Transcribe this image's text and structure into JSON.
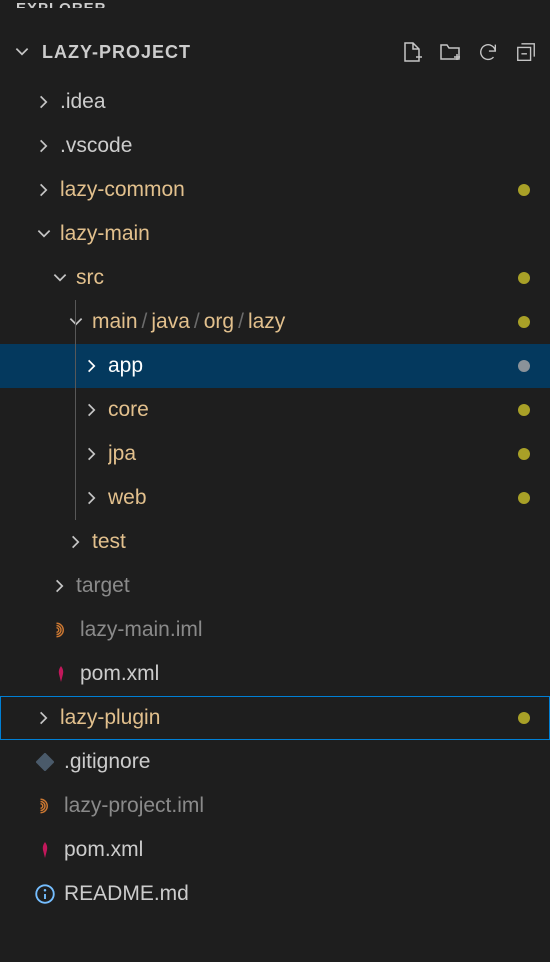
{
  "explorer_label": "EXPLORER",
  "panel": {
    "title": "LAZY-PROJECT"
  },
  "tree": {
    "idea": ".idea",
    "vscode": ".vscode",
    "lazy_common": "lazy-common",
    "lazy_main": "lazy-main",
    "src": "src",
    "main": "main",
    "java": "java",
    "org": "org",
    "lazy": "lazy",
    "app": "app",
    "core": "core",
    "jpa": "jpa",
    "web": "web",
    "test": "test",
    "target": "target",
    "lazy_main_iml": "lazy-main.iml",
    "pom_xml": "pom.xml",
    "lazy_plugin": "lazy-plugin",
    "gitignore": ".gitignore",
    "lazy_project_iml": "lazy-project.iml",
    "readme": "README.md"
  }
}
